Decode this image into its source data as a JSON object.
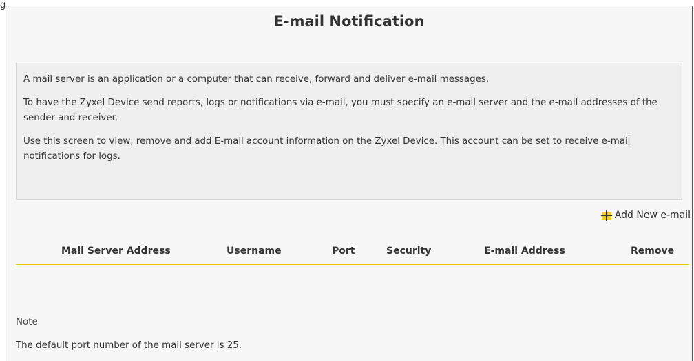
{
  "figure_label": "g",
  "title": "E-mail Notification",
  "info": {
    "p1": "A mail server is an application or a computer that can receive, forward and deliver e-mail messages.",
    "p2": "To have the Zyxel Device send reports, logs or notifications via e-mail, you must specify an e-mail server and the e-mail addresses of the sender and receiver.",
    "p3": "Use this screen to view, remove and add E-mail account information on the Zyxel Device. This account can be set to receive e-mail notifications for logs."
  },
  "add_button": {
    "label": "Add New e-mail",
    "icon": "plus-icon",
    "icon_color": "#f2c400"
  },
  "table": {
    "columns": [
      "Mail Server Address",
      "Username",
      "Port",
      "Security",
      "E-mail Address",
      "Remove"
    ],
    "rows": []
  },
  "note": {
    "label": "Note",
    "text": "The default port number of the mail server is 25."
  },
  "colors": {
    "accent": "#f2c400",
    "panel_bg": "#f7f7f7",
    "info_bg": "#efefef"
  }
}
